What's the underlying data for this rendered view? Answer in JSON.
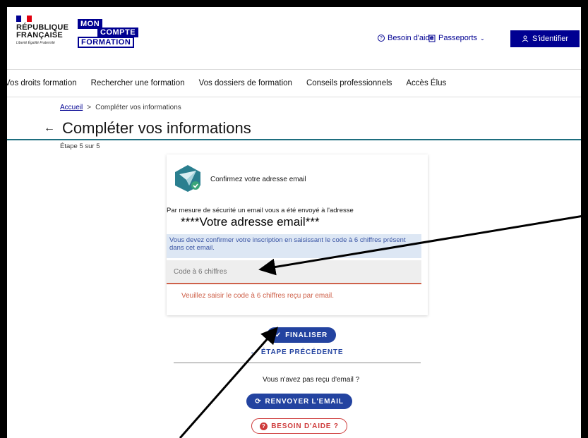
{
  "header": {
    "rf_title_line1": "RÉPUBLIQUE",
    "rf_title_line2": "FRANÇAISE",
    "rf_motto": "Liberté Égalité Fraternité",
    "mcf_mon": "MON",
    "mcf_compte": "COMPTE",
    "mcf_formation": "FORMATION",
    "help_label": "Besoin d'aide",
    "passports_label": "Passeports",
    "login_label": "S'identifier"
  },
  "nav": {
    "items": [
      "Vos droits formation",
      "Rechercher une formation",
      "Vos dossiers de formation",
      "Conseils professionnels",
      "Accès Élus"
    ]
  },
  "breadcrumb": {
    "home": "Accueil",
    "separator": ">",
    "current": "Compléter vos informations"
  },
  "page": {
    "title": "Compléter vos informations",
    "back_glyph": "←",
    "step": "Étape 5 sur 5"
  },
  "card": {
    "heading": "Confirmez votre adresse email",
    "info": "Par mesure de sécurité un email vous a été envoyé à l'adresse",
    "email": "****Votre adresse email***",
    "notice": "Vous devez confirmer votre inscription en saisissant le code à 6 chiffres présent dans cet email.",
    "code_placeholder": "Code à 6 chiffres",
    "code_error": "Veuillez saisir le code à 6 chiffres reçu par email."
  },
  "actions": {
    "finalize_label": "FINALISER",
    "prev_label": "ÉTAPE PRÉCÉDENTE",
    "no_email_text": "Vous n'avez pas reçu d'email ?",
    "resend_label": "RENVOYER L'EMAIL",
    "help_label": "BESOIN D'AIDE ?"
  },
  "colors": {
    "brand_blue": "#000091",
    "button_blue": "#2343a0",
    "error": "#ce614a",
    "notice_bg": "#dde7f4",
    "title_rule": "#1e6e7f"
  },
  "icons": [
    "help-circle-icon",
    "document-icon",
    "chevron-down-icon",
    "user-icon",
    "back-arrow-icon",
    "envelope-check-icon",
    "check-icon",
    "refresh-icon",
    "question-circle-icon"
  ]
}
